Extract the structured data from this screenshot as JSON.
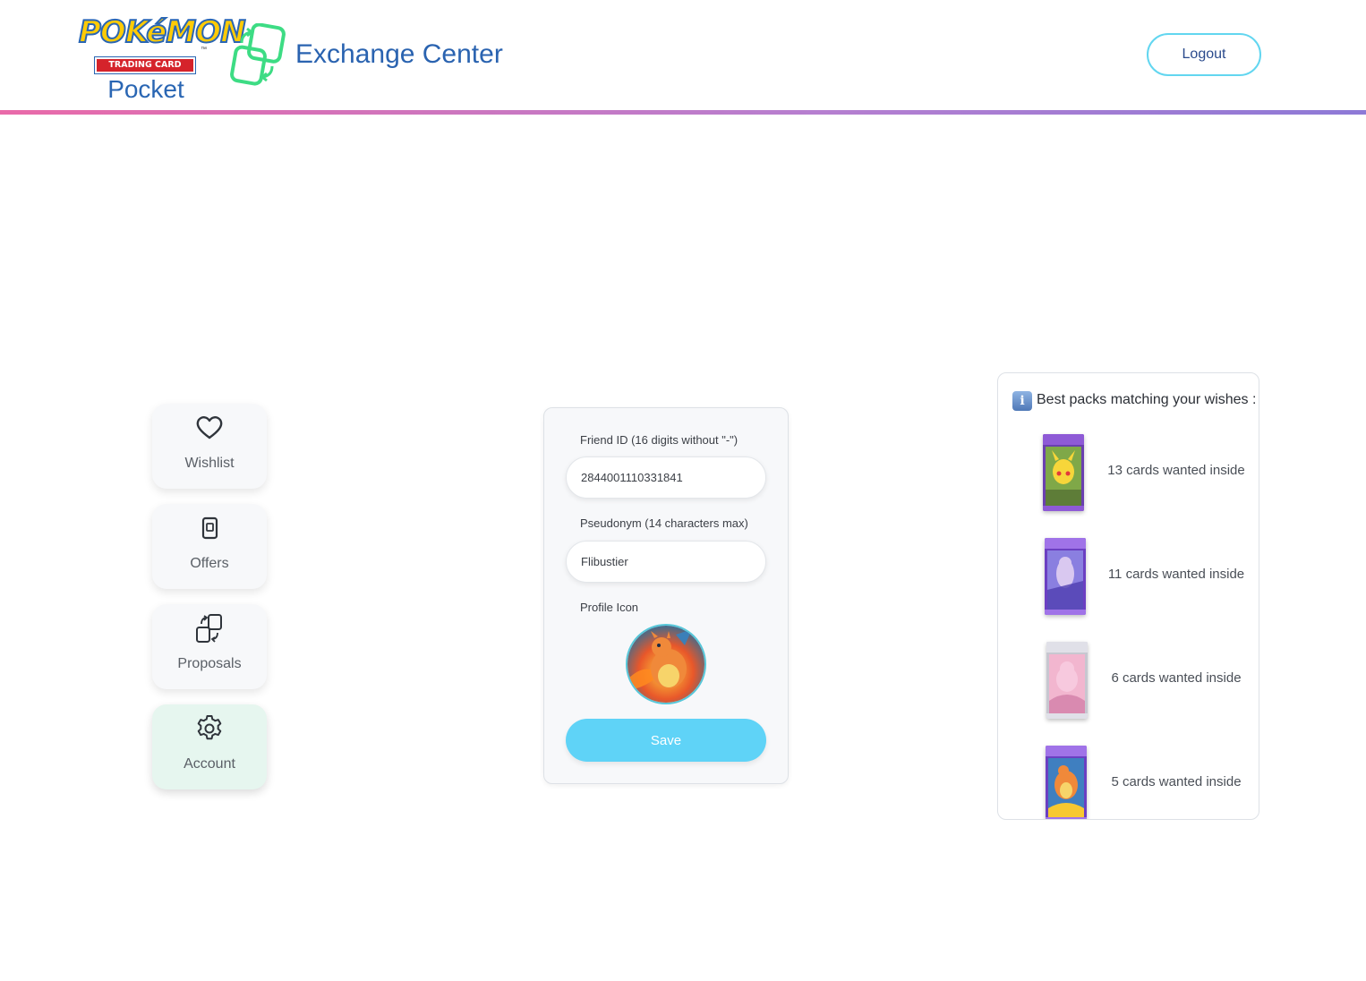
{
  "header": {
    "logo_word": "POKéMON",
    "logo_band": "TRADING CARD GAME",
    "logo_tm": "™",
    "logo_sub": "Pocket",
    "title": "Exchange Center",
    "logout_label": "Logout"
  },
  "colors": {
    "accent_blue": "#2a63b0",
    "save_button": "#5fd3f7",
    "logout_border": "#62d6f0",
    "active_nav": "#e6f6ef",
    "brand_icon_green": "#3ddc84"
  },
  "sidebar": {
    "items": [
      {
        "label": "Wishlist",
        "icon": "heart-icon",
        "active": false
      },
      {
        "label": "Offers",
        "icon": "card-icon",
        "active": false
      },
      {
        "label": "Proposals",
        "icon": "exchange-icon",
        "active": false
      },
      {
        "label": "Account",
        "icon": "gear-icon",
        "active": true
      }
    ]
  },
  "form": {
    "friend_id_label": "Friend ID (16 digits without \"-\")",
    "friend_id_value": "2844001110331841",
    "pseudonym_label": "Pseudonym (14 characters max)",
    "pseudonym_value": "Flibustier",
    "profile_icon_label": "Profile Icon",
    "profile_icon": "charizard-avatar",
    "save_label": "Save"
  },
  "packs": {
    "info_icon": "info-icon",
    "title": "Best packs matching your wishes :",
    "items": [
      {
        "text": "13 cards wanted inside",
        "pack": "pikachu-pack"
      },
      {
        "text": "11 cards wanted inside",
        "pack": "mewtwo-pack"
      },
      {
        "text": "6 cards wanted inside",
        "pack": "mew-pack"
      },
      {
        "text": "5 cards wanted inside",
        "pack": "charizard-pack"
      }
    ]
  }
}
